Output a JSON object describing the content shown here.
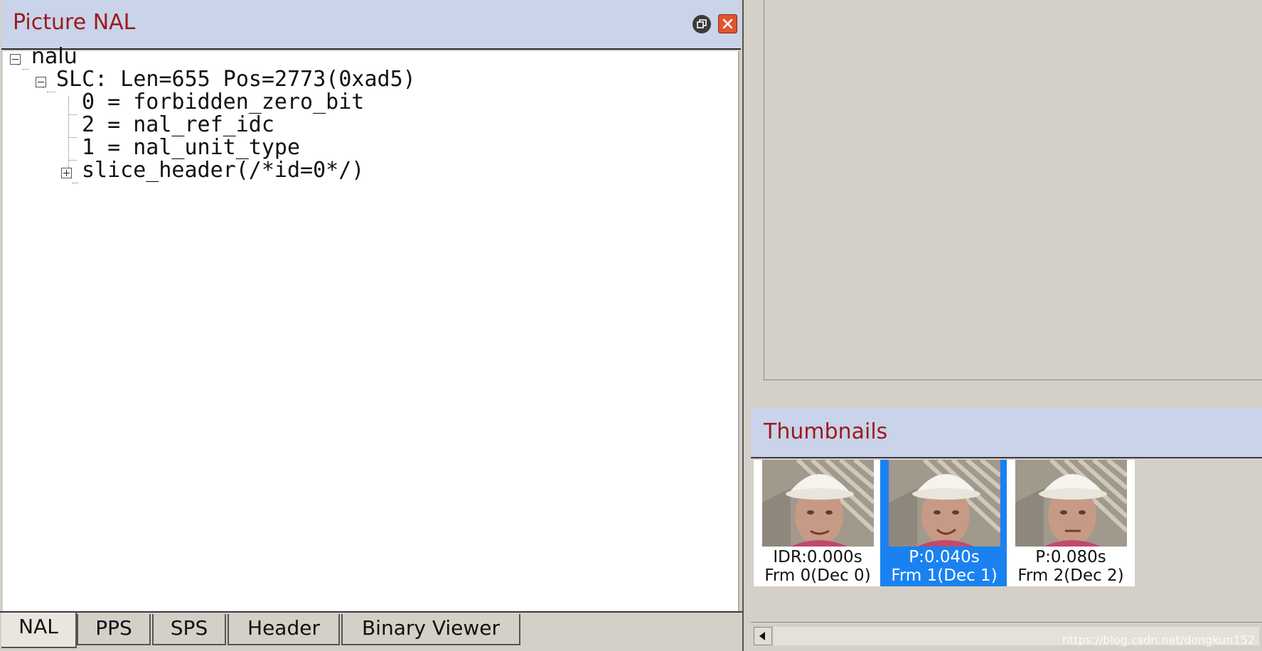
{
  "nal_panel": {
    "title": "Picture NAL",
    "tree": {
      "root": "nalu",
      "slice": "SLC: Len=655 Pos=2773(0xad5)",
      "fields": [
        "0 = forbidden_zero_bit",
        "2 = nal_ref_idc",
        "1 = nal_unit_type"
      ],
      "slice_header": "slice_header(/*id=0*/)"
    },
    "tabs": [
      {
        "label": "NAL",
        "active": true
      },
      {
        "label": "PPS",
        "active": false
      },
      {
        "label": "SPS",
        "active": false
      },
      {
        "label": "Header",
        "active": false
      },
      {
        "label": "Binary Viewer",
        "active": false
      }
    ]
  },
  "thumbnails_panel": {
    "title": "Thumbnails",
    "items": [
      {
        "line1": "IDR:0.000s",
        "line2": "Frm 0(Dec 0)",
        "selected": false
      },
      {
        "line1": "P:0.040s",
        "line2": "Frm 1(Dec 1)",
        "selected": true
      },
      {
        "line1": "P:0.080s",
        "line2": "Frm 2(Dec 2)",
        "selected": false
      }
    ]
  },
  "watermark": "https://blog.csdn.net/dongkun152",
  "colors": {
    "title_bg": "#c9d3ea",
    "title_text": "#9a1b1b",
    "selection": "#1a82f0",
    "close_button": "#e0552f"
  }
}
